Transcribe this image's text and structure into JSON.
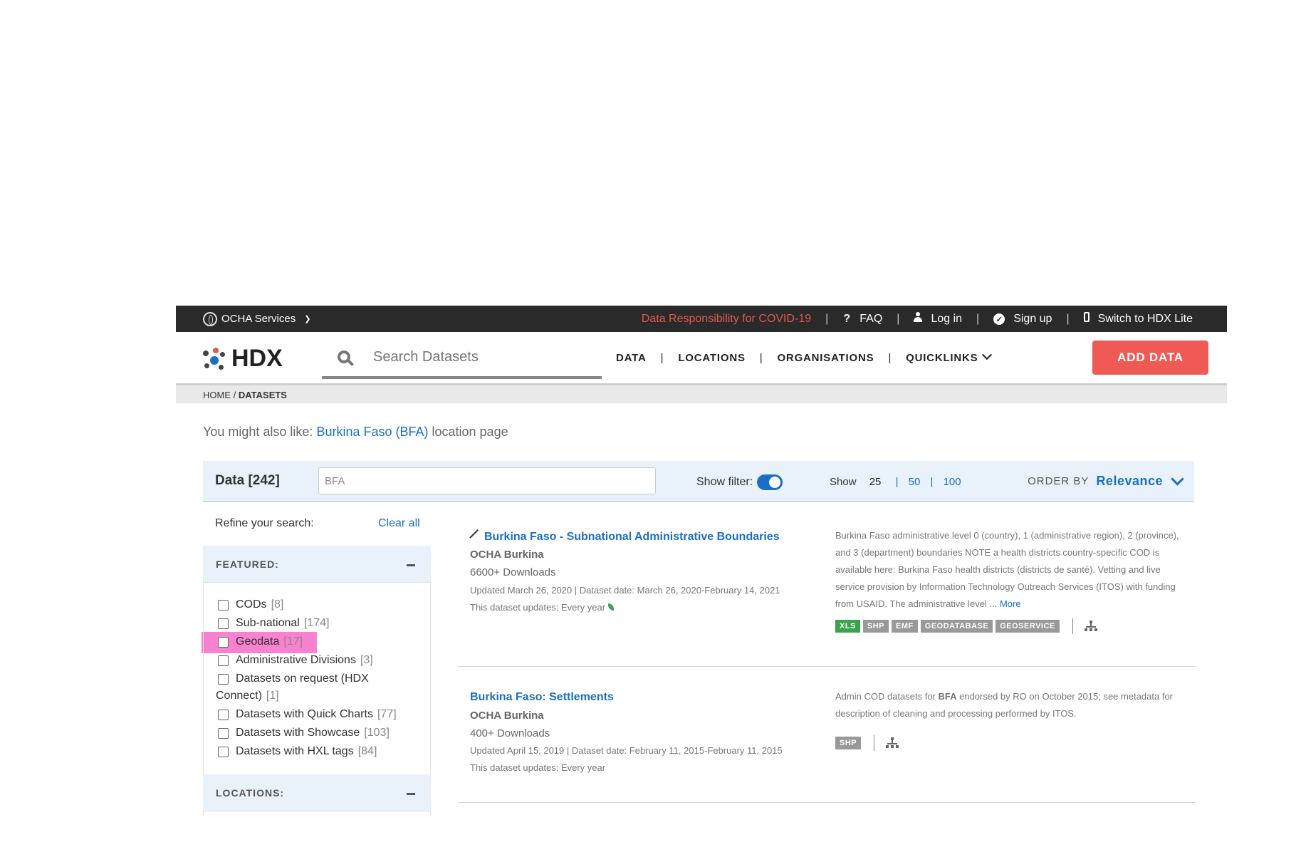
{
  "topbar": {
    "ocha_services": "OCHA Services",
    "covid_link": "Data Responsibility for COVID-19",
    "faq": "FAQ",
    "login": "Log in",
    "signup": "Sign up",
    "switch_lite": "Switch to HDX Lite",
    "separator": "|"
  },
  "header": {
    "logo_text": "HDX",
    "search_placeholder": "Search Datasets",
    "nav": [
      "DATA",
      "LOCATIONS",
      "ORGANISATIONS",
      "QUICKLINKS"
    ],
    "add_data": "ADD DATA"
  },
  "breadcrumb": {
    "home": "HOME",
    "sep": " / ",
    "current": "DATASETS"
  },
  "suggestion": {
    "prefix": "You might also like: ",
    "link": "Burkina Faso (BFA)",
    "suffix": " location page"
  },
  "databar": {
    "title": "Data [242]",
    "query": "BFA",
    "show_filter_label": "Show filter:",
    "show_filter_on": true,
    "show_label": "Show",
    "page_sizes": [
      "25",
      "50",
      "100"
    ],
    "current_page_size": "25",
    "order_by_label": "ORDER BY",
    "order_by_value": "Relevance"
  },
  "sidebar": {
    "refine_label": "Refine your search:",
    "clear_all": "Clear all",
    "featured_title": "FEATURED:",
    "featured_items": [
      {
        "label": "CODs",
        "count": "[8]"
      },
      {
        "label": "Sub-national",
        "count": "[174]"
      },
      {
        "label": "Geodata",
        "count": "[17]"
      },
      {
        "label": "Administrative Divisions",
        "count": "[3]"
      },
      {
        "label": "Datasets on request (HDX",
        "label2": "Connect)",
        "count": "[1]"
      },
      {
        "label": "Datasets with Quick Charts",
        "count": "[77]"
      },
      {
        "label": "Datasets with Showcase",
        "count": "[103]"
      },
      {
        "label": "Datasets with HXL tags",
        "count": "[84]"
      }
    ],
    "locations_title": "LOCATIONS:"
  },
  "results": [
    {
      "title": "Burkina Faso - Subnational Administrative Boundaries",
      "org": "OCHA Burkina",
      "downloads": "6600+ Downloads",
      "updated": "Updated March 26, 2020 | Dataset date: March 26, 2020-February 14, 2021",
      "frequency": "This dataset updates: Every year",
      "description": "Burkina Faso administrative level 0 (country), 1 (administrative region), 2 (province), and 3 (department) boundaries NOTE a health districts country-specific COD is available here: Burkina Faso health districts (districts de santé). Vetting and live service provision by Information Technology Outreach Services (ITOS) with funding from USAID. The administrative level",
      "more": "... More",
      "tags": [
        "XLS",
        "SHP",
        "EMF",
        "GEODATABASE",
        "GEOSERVICE"
      ]
    },
    {
      "title": "Burkina Faso: Settlements",
      "org": "OCHA Burkina",
      "downloads": "400+ Downloads",
      "updated": "Updated April 15, 2019 | Dataset date: February 11, 2015-February 11, 2015",
      "frequency": "This dataset updates: Every year",
      "description_pre": "Admin COD datasets for ",
      "description_bold": "BFA",
      "description_post": " endorsed by RO on October 2015; see metadata for description of cleaning and processing performed by ITOS.",
      "tags": [
        "SHP"
      ]
    }
  ],
  "colors": {
    "topbar_bg": "#2a2a2a",
    "accent_red": "#ef5b54",
    "link_blue": "#1a6fc4",
    "highlight_pink": "#f76bc8",
    "xls_green": "#3aa34b"
  }
}
